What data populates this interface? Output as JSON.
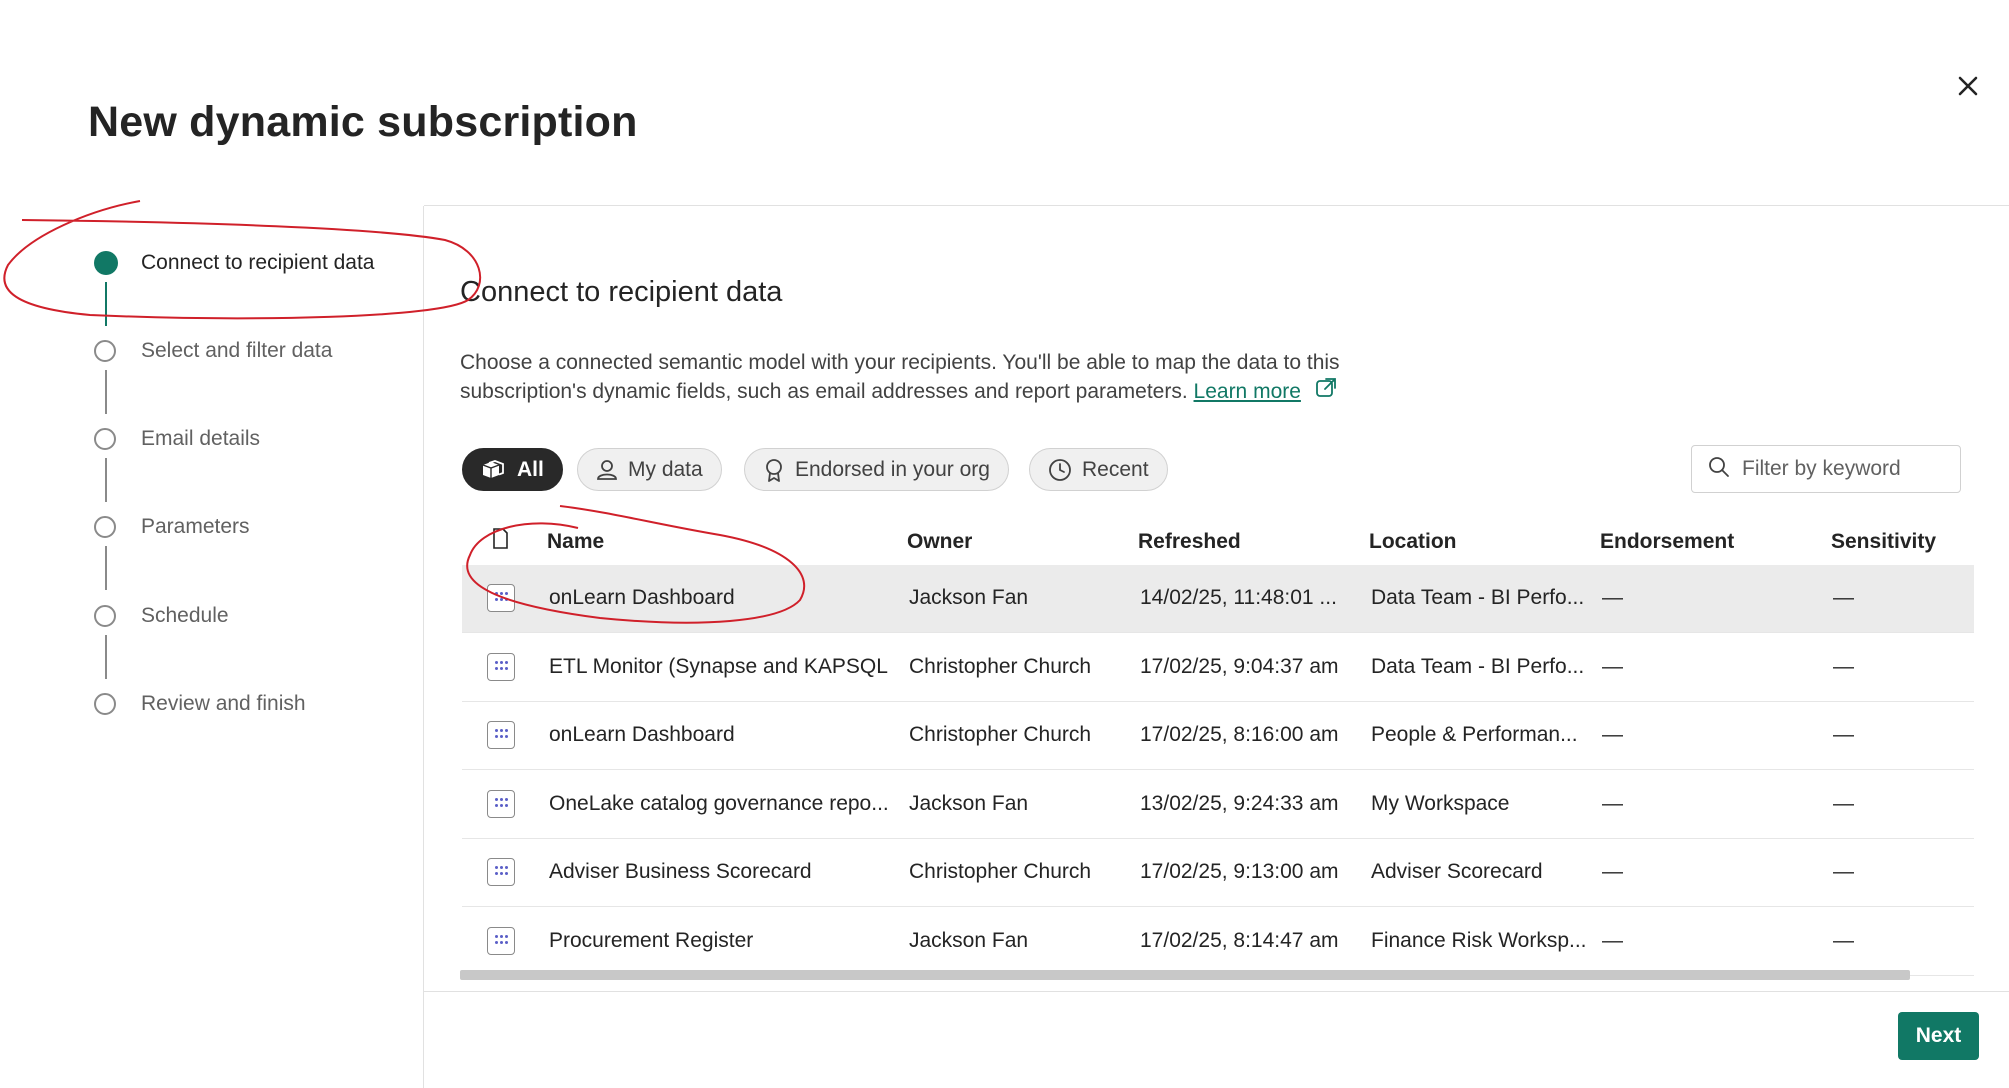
{
  "dialog": {
    "title": "New dynamic subscription"
  },
  "steps": [
    {
      "label": "Connect to recipient data",
      "state": "active"
    },
    {
      "label": "Select and filter data",
      "state": "pending"
    },
    {
      "label": "Email details",
      "state": "pending"
    },
    {
      "label": "Parameters",
      "state": "pending"
    },
    {
      "label": "Schedule",
      "state": "pending"
    },
    {
      "label": "Review and finish",
      "state": "pending"
    }
  ],
  "main": {
    "heading": "Connect to recipient data",
    "description": "Choose a connected semantic model with your recipients. You'll be able to map the data to this subscription's dynamic fields, such as email addresses and report parameters.",
    "learn_more": "Learn more",
    "filters": [
      {
        "label": "All",
        "icon": "cube-stack-icon",
        "selected": true
      },
      {
        "label": "My data",
        "icon": "person-icon",
        "selected": false
      },
      {
        "label": "Endorsed in your org",
        "icon": "ribbon-icon",
        "selected": false
      },
      {
        "label": "Recent",
        "icon": "clock-icon",
        "selected": false
      }
    ],
    "search_placeholder": "Filter by keyword"
  },
  "table": {
    "columns": [
      "Name",
      "Owner",
      "Refreshed",
      "Location",
      "Endorsement",
      "Sensitivity"
    ],
    "rows": [
      {
        "name": "onLearn Dashboard",
        "owner": "Jackson Fan",
        "refreshed": "14/02/25, 11:48:01 ...",
        "location": "Data Team - BI Perfo...",
        "endorsement": "—",
        "sensitivity": "—",
        "selected": true
      },
      {
        "name": "ETL Monitor (Synapse and KAPSQL...",
        "owner": "Christopher Church",
        "refreshed": "17/02/25, 9:04:37 am",
        "location": "Data Team - BI Perfo...",
        "endorsement": "—",
        "sensitivity": "—",
        "selected": false
      },
      {
        "name": "onLearn Dashboard",
        "owner": "Christopher Church",
        "refreshed": "17/02/25, 8:16:00 am",
        "location": "People & Performan...",
        "endorsement": "—",
        "sensitivity": "—",
        "selected": false
      },
      {
        "name": "OneLake catalog governance repo...",
        "owner": "Jackson Fan",
        "refreshed": "13/02/25, 9:24:33 am",
        "location": "My Workspace",
        "endorsement": "—",
        "sensitivity": "—",
        "selected": false
      },
      {
        "name": "Adviser Business Scorecard",
        "owner": "Christopher Church",
        "refreshed": "17/02/25, 9:13:00 am",
        "location": "Adviser Scorecard",
        "endorsement": "—",
        "sensitivity": "—",
        "selected": false
      },
      {
        "name": "Procurement Register",
        "owner": "Jackson Fan",
        "refreshed": "17/02/25, 8:14:47 am",
        "location": "Finance Risk Worksp...",
        "endorsement": "—",
        "sensitivity": "—",
        "selected": false
      }
    ]
  },
  "footer": {
    "next_label": "Next"
  },
  "colors": {
    "accent": "#117865",
    "annotation": "#d0202a",
    "selected_chip": "#292929"
  }
}
